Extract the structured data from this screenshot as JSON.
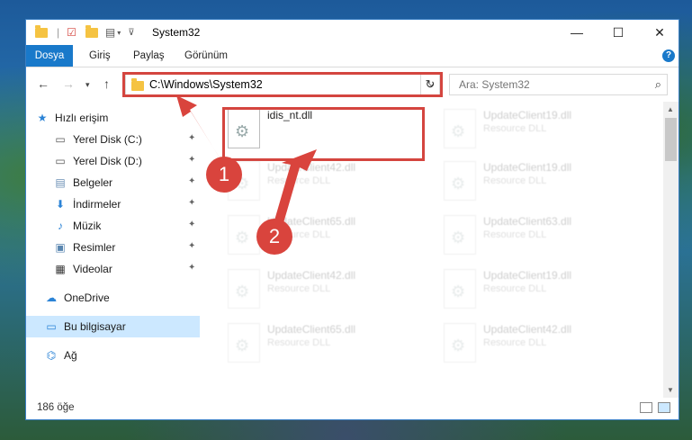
{
  "window": {
    "title": "System32",
    "minimize": "—",
    "maximize": "☐",
    "close": "✕"
  },
  "ribbon": {
    "tabs": [
      "Dosya",
      "Giriş",
      "Paylaş",
      "Görünüm"
    ],
    "help": "?"
  },
  "address": {
    "path": "C:\\Windows\\System32",
    "search_placeholder": "Ara: System32"
  },
  "sidebar": {
    "items": [
      {
        "label": "Hızlı erişim",
        "icon": "star-icon"
      },
      {
        "label": "Yerel Disk (C:)",
        "icon": "drive-icon",
        "pinned": true
      },
      {
        "label": "Yerel Disk (D:)",
        "icon": "drive-icon",
        "pinned": true
      },
      {
        "label": "Belgeler",
        "icon": "documents-icon",
        "pinned": true
      },
      {
        "label": "İndirmeler",
        "icon": "downloads-icon",
        "pinned": true
      },
      {
        "label": "Müzik",
        "icon": "music-icon",
        "pinned": true
      },
      {
        "label": "Resimler",
        "icon": "pictures-icon",
        "pinned": true
      },
      {
        "label": "Videolar",
        "icon": "videos-icon",
        "pinned": true
      },
      {
        "label": "OneDrive",
        "icon": "cloud-icon"
      },
      {
        "label": "Bu bilgisayar",
        "icon": "computer-icon",
        "selected": true
      },
      {
        "label": "Ağ",
        "icon": "network-icon"
      }
    ]
  },
  "files": [
    {
      "name": "idis_nt.dll",
      "type": ""
    },
    {
      "name": "UpdateClient19.dll",
      "type": "Resource DLL"
    },
    {
      "name": "UpdateClient42.dll",
      "type": "Resource DLL"
    },
    {
      "name": "UpdateClient19.dll",
      "type": "Resource DLL"
    },
    {
      "name": "UpdateClient65.dll",
      "type": "Resource DLL"
    },
    {
      "name": "UpdateClient63.dll",
      "type": "Resource DLL"
    },
    {
      "name": "UpdateClient42.dll",
      "type": "Resource DLL"
    },
    {
      "name": "UpdateClient19.dll",
      "type": "Resource DLL"
    },
    {
      "name": "UpdateClient65.dll",
      "type": "Resource DLL"
    },
    {
      "name": "UpdateClient42.dll",
      "type": "Resource DLL"
    }
  ],
  "status": {
    "count": "186 öğe"
  },
  "callouts": [
    "1",
    "2"
  ],
  "colors": {
    "accent": "#1979ca",
    "highlight": "#d4453f",
    "selection": "#cce8ff"
  }
}
